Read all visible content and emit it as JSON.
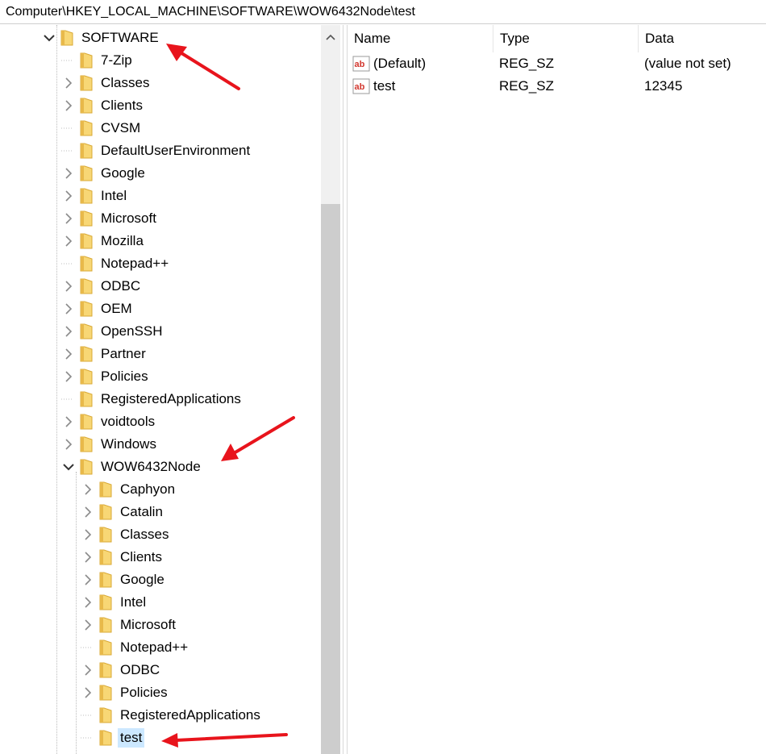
{
  "address_bar": {
    "path": "Computer\\HKEY_LOCAL_MACHINE\\SOFTWARE\\WOW6432Node\\test"
  },
  "tree": {
    "software": {
      "label": "SOFTWARE",
      "expanded": true
    },
    "software_children": [
      {
        "label": "7-Zip",
        "expandable": false
      },
      {
        "label": "Classes",
        "expandable": true
      },
      {
        "label": "Clients",
        "expandable": true
      },
      {
        "label": "CVSM",
        "expandable": false
      },
      {
        "label": "DefaultUserEnvironment",
        "expandable": false
      },
      {
        "label": "Google",
        "expandable": true
      },
      {
        "label": "Intel",
        "expandable": true
      },
      {
        "label": "Microsoft",
        "expandable": true
      },
      {
        "label": "Mozilla",
        "expandable": true
      },
      {
        "label": "Notepad++",
        "expandable": false
      },
      {
        "label": "ODBC",
        "expandable": true
      },
      {
        "label": "OEM",
        "expandable": true
      },
      {
        "label": "OpenSSH",
        "expandable": true
      },
      {
        "label": "Partner",
        "expandable": true
      },
      {
        "label": "Policies",
        "expandable": true
      },
      {
        "label": "RegisteredApplications",
        "expandable": false
      },
      {
        "label": "voidtools",
        "expandable": true
      },
      {
        "label": "Windows",
        "expandable": true
      },
      {
        "label": "WOW6432Node",
        "expandable": true,
        "expanded": true
      }
    ],
    "wow_children": [
      {
        "label": "Caphyon",
        "expandable": true
      },
      {
        "label": "Catalin",
        "expandable": true
      },
      {
        "label": "Classes",
        "expandable": true
      },
      {
        "label": "Clients",
        "expandable": true
      },
      {
        "label": "Google",
        "expandable": true
      },
      {
        "label": "Intel",
        "expandable": true
      },
      {
        "label": "Microsoft",
        "expandable": true
      },
      {
        "label": "Notepad++",
        "expandable": false
      },
      {
        "label": "ODBC",
        "expandable": true
      },
      {
        "label": "Policies",
        "expandable": true
      },
      {
        "label": "RegisteredApplications",
        "expandable": false
      },
      {
        "label": "test",
        "expandable": false,
        "selected": true
      }
    ]
  },
  "values_pane": {
    "columns": {
      "name": "Name",
      "type": "Type",
      "data": "Data"
    },
    "rows": [
      {
        "icon": "string-value-icon",
        "name": "(Default)",
        "type": "REG_SZ",
        "data": "(value not set)"
      },
      {
        "icon": "string-value-icon",
        "name": "test",
        "type": "REG_SZ",
        "data": "12345"
      }
    ]
  },
  "annotation_color": "#e8141c",
  "folder_color": "#f8d775"
}
